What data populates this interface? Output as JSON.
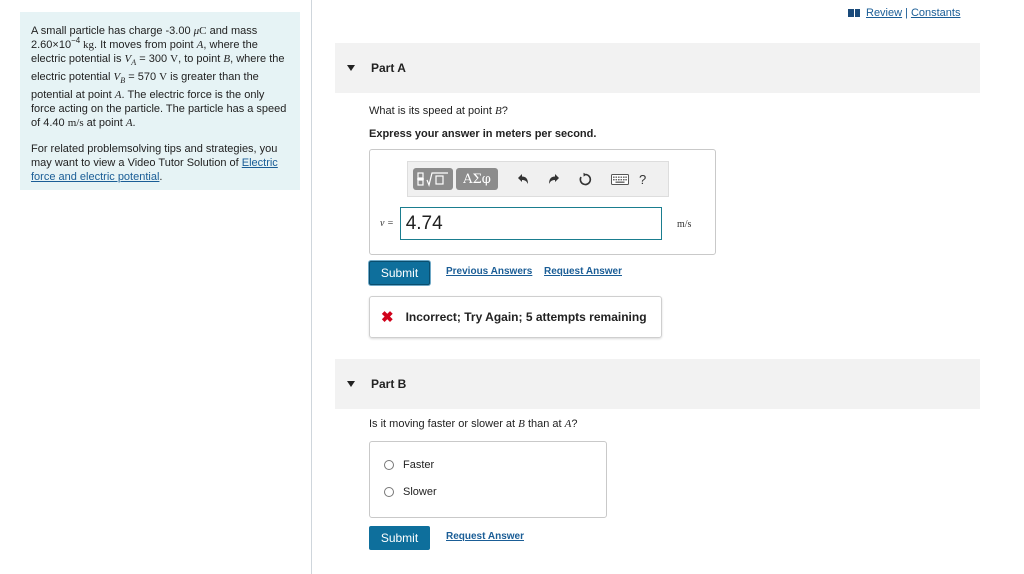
{
  "problem": {
    "p1_t1": "A small particle has charge -3.00 ",
    "p1_mu": "μ",
    "p1_C": "C",
    "p1_t2": " and mass 2.60×10",
    "p1_exp": "−4",
    "p1_kg": " kg",
    "p1_t3": ". It moves from point ",
    "p1_A1": "A",
    "p1_t4": ", where the electric potential is ",
    "p1_VA": "V",
    "p1_VA_sub": "A",
    "p1_t5": " = 300 ",
    "p1_V1": "V",
    "p1_t6": ", to point ",
    "p1_B1": "B",
    "p1_t7": ", where the electric potential ",
    "p1_VB": "V",
    "p1_VB_sub": "B",
    "p1_t8": " = 570 ",
    "p1_V2": "V",
    "p1_t9": " is greater than the potential at point ",
    "p1_A2": "A",
    "p1_t10": ". The electric force is the only force acting on the particle. The particle has a speed of 4.40 ",
    "p1_ms": "m/s",
    "p1_t11": " at point ",
    "p1_A3": "A",
    "p1_t12": ".",
    "p2_text": "For related problemsolving tips and strategies, you may want to view a Video Tutor Solution of ",
    "p2_link": "Electric force and electric potential",
    "p2_end": "."
  },
  "header_links": {
    "review": "Review",
    "sep": "|",
    "constants": "Constants"
  },
  "part_a": {
    "title": "Part A",
    "q_text": "What is its speed at point ",
    "q_var": "B",
    "q_end": "?",
    "instruction": "Express your answer in meters per second.",
    "toolbar": {
      "template_icon": "fraction-sqrt-template-icon",
      "greek_label": "ΑΣφ",
      "undo_icon": "undo-icon",
      "redo_icon": "redo-icon",
      "reset_icon": "reset-icon",
      "keyboard_icon": "keyboard-icon",
      "help_label": "?"
    },
    "var_label": "v =",
    "answer_value": "4.74",
    "unit": "m/s",
    "submit": "Submit",
    "previous_answers": "Previous Answers",
    "request_answer": "Request Answer",
    "feedback_mark": "✖",
    "feedback": "Incorrect; Try Again; 5 attempts remaining"
  },
  "part_b": {
    "title": "Part B",
    "q_text": "Is it moving faster or slower at ",
    "q_var1": "B",
    "q_mid": " than at ",
    "q_var2": "A",
    "q_end": "?",
    "options": [
      "Faster",
      "Slower"
    ],
    "submit": "Submit",
    "request_answer": "Request Answer"
  },
  "colors": {
    "info_bg": "#e6f3f5",
    "link": "#1a5d96",
    "submit_bg": "#0e6f9c",
    "error": "#d0021b",
    "part_header_bg": "#f2f2f2"
  }
}
